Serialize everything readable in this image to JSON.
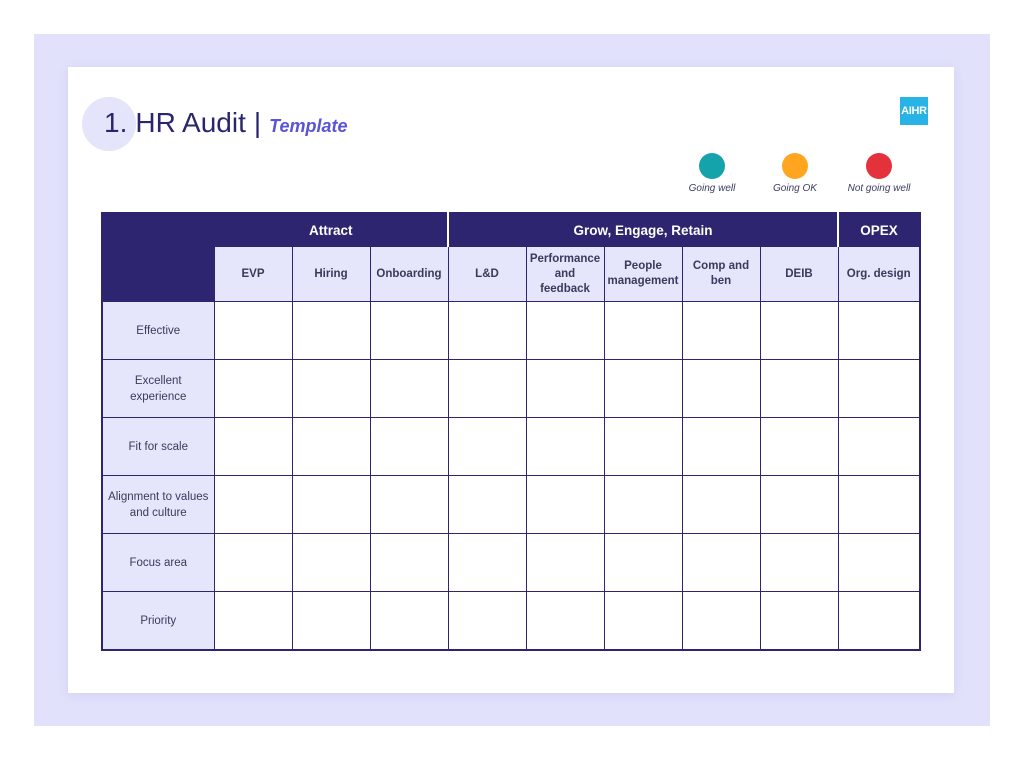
{
  "title": {
    "number": "1.",
    "main": "HR Audit",
    "separator": "|",
    "subtitle": "Template"
  },
  "logo": {
    "text": "AIHR",
    "color": "#27b3e6"
  },
  "legend": [
    {
      "label": "Going well",
      "color": "#14a3ab"
    },
    {
      "label": "Going OK",
      "color": "#ffa51f"
    },
    {
      "label": "Not going well",
      "color": "#e4323c"
    }
  ],
  "table": {
    "groups": [
      {
        "label": "Attract",
        "span": 3
      },
      {
        "label": "Grow, Engage, Retain",
        "span": 5
      },
      {
        "label": "OPEX",
        "span": 1
      }
    ],
    "columns": [
      "EVP",
      "Hiring",
      "Onboarding",
      "L&D",
      "Performance and feedback",
      "People management",
      "Comp and ben",
      "DEIB",
      "Org. design"
    ],
    "rows": [
      "Effective",
      "Excellent experience",
      "Fit for scale",
      "Alignment to values and culture",
      "Focus area",
      "Priority"
    ]
  }
}
